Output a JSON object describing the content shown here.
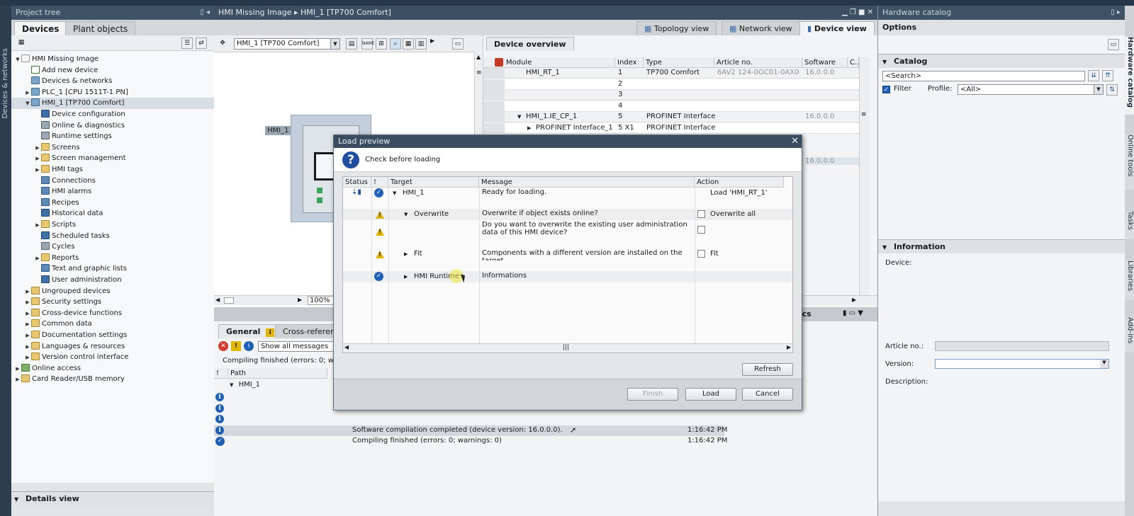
{
  "project_tree": {
    "title": "Project tree",
    "tabs": [
      "Devices",
      "Plant objects"
    ],
    "side_label": "Devices & networks",
    "items": [
      {
        "label": "HMI Missing Image",
        "indent": 0,
        "arrow": "▼",
        "icon": "doc"
      },
      {
        "label": "Add new device",
        "indent": 1,
        "arrow": "",
        "icon": "plus"
      },
      {
        "label": "Devices & networks",
        "indent": 1,
        "arrow": "",
        "icon": "dev"
      },
      {
        "label": "PLC_1 [CPU 1511T-1 PN]",
        "indent": 1,
        "arrow": "▶",
        "icon": "dev"
      },
      {
        "label": "HMI_1 [TP700 Comfort]",
        "indent": 1,
        "arrow": "▼",
        "icon": "dev"
      },
      {
        "label": "Device configuration",
        "indent": 2,
        "arrow": "",
        "icon": "blue"
      },
      {
        "label": "Online & diagnostics",
        "indent": 2,
        "arrow": "",
        "icon": "gear"
      },
      {
        "label": "Runtime settings",
        "indent": 2,
        "arrow": "",
        "icon": "gear"
      },
      {
        "label": "Screens",
        "indent": 2,
        "arrow": "▶",
        "icon": "folder"
      },
      {
        "label": "Screen management",
        "indent": 2,
        "arrow": "▶",
        "icon": "folder"
      },
      {
        "label": "HMI tags",
        "indent": 2,
        "arrow": "▶",
        "icon": "folder"
      },
      {
        "label": "Connections",
        "indent": 2,
        "arrow": "",
        "icon": "tag"
      },
      {
        "label": "HMI alarms",
        "indent": 2,
        "arrow": "",
        "icon": "tag"
      },
      {
        "label": "Recipes",
        "indent": 2,
        "arrow": "",
        "icon": "tag"
      },
      {
        "label": "Historical data",
        "indent": 2,
        "arrow": "",
        "icon": "blue"
      },
      {
        "label": "Scripts",
        "indent": 2,
        "arrow": "▶",
        "icon": "folder"
      },
      {
        "label": "Scheduled tasks",
        "indent": 2,
        "arrow": "",
        "icon": "blue"
      },
      {
        "label": "Cycles",
        "indent": 2,
        "arrow": "",
        "icon": "gear"
      },
      {
        "label": "Reports",
        "indent": 2,
        "arrow": "▶",
        "icon": "folder"
      },
      {
        "label": "Text and graphic lists",
        "indent": 2,
        "arrow": "",
        "icon": "tag"
      },
      {
        "label": "User administration",
        "indent": 2,
        "arrow": "",
        "icon": "blue"
      },
      {
        "label": "Ungrouped devices",
        "indent": 1,
        "arrow": "▶",
        "icon": "folder"
      },
      {
        "label": "Security settings",
        "indent": 1,
        "arrow": "▶",
        "icon": "folder"
      },
      {
        "label": "Cross-device functions",
        "indent": 1,
        "arrow": "▶",
        "icon": "folder"
      },
      {
        "label": "Common data",
        "indent": 1,
        "arrow": "▶",
        "icon": "folder"
      },
      {
        "label": "Documentation settings",
        "indent": 1,
        "arrow": "▶",
        "icon": "folder"
      },
      {
        "label": "Languages & resources",
        "indent": 1,
        "arrow": "▶",
        "icon": "folder"
      },
      {
        "label": "Version control interface",
        "indent": 1,
        "arrow": "▶",
        "icon": "folder"
      },
      {
        "label": "Online access",
        "indent": 0,
        "arrow": "▶",
        "icon": "green"
      },
      {
        "label": "Card Reader/USB memory",
        "indent": 0,
        "arrow": "▶",
        "icon": "folder"
      }
    ],
    "details_view": "Details view"
  },
  "editor": {
    "title": "HMI Missing Image  ▸  HMI_1 [TP700 Comfort]",
    "view_tabs": [
      "Topology view",
      "Network view",
      "Device view"
    ],
    "device_select": "HMI_1 [TP700 Comfort]",
    "device_label": "HMI_1",
    "zoom": "100%",
    "device_overview": {
      "title": "Device overview",
      "columns": [
        "Module",
        "Index",
        "Type",
        "Article no.",
        "Software or...",
        "C..."
      ],
      "rows": [
        {
          "module": "HMI_RT_1",
          "index": "1",
          "type": "TP700 Comfort",
          "article": "6AV2 124-0GC01-0AX0",
          "software": "16.0.0.0",
          "indent": 1,
          "arrow": ""
        },
        {
          "module": "",
          "index": "2",
          "type": "",
          "article": "",
          "software": "",
          "indent": 1,
          "arrow": ""
        },
        {
          "module": "",
          "index": "3",
          "type": "",
          "article": "",
          "software": "",
          "indent": 1,
          "arrow": ""
        },
        {
          "module": "",
          "index": "4",
          "type": "",
          "article": "",
          "software": "",
          "indent": 1,
          "arrow": ""
        },
        {
          "module": "HMI_1.IE_CP_1",
          "index": "5",
          "type": "PROFINET Interface",
          "article": "",
          "software": "16.0.0.0",
          "indent": 1,
          "arrow": "▼"
        },
        {
          "module": "PROFINET Interface_1",
          "index": "5 X1",
          "type": "PROFINET Interface",
          "article": "",
          "software": "",
          "indent": 2,
          "arrow": "▶"
        }
      ],
      "extra_software": "16.0.0.0"
    }
  },
  "inspector": {
    "tabs": [
      "General",
      "Cross-referen"
    ],
    "diagnostics_label": "stics",
    "filter": "Show all messages",
    "compile_status": "Compiling finished (errors: 0; warnin",
    "columns": [
      "!",
      "Path"
    ],
    "path_root": "HMI_1",
    "messages": [
      {
        "icon": "info",
        "text": "",
        "time": ""
      },
      {
        "icon": "info",
        "text": "",
        "time": ""
      },
      {
        "icon": "info",
        "text": "",
        "time": ""
      },
      {
        "icon": "info",
        "text": "Software compilation completed (device version: 16.0.0.0).",
        "time": "1:16:42 PM"
      },
      {
        "icon": "ok",
        "text": "Compiling finished (errors: 0; warnings: 0)",
        "time": "1:16:42 PM"
      }
    ]
  },
  "dialog": {
    "title": "Load preview",
    "heading": "Check before loading",
    "columns": [
      "Status",
      "!",
      "Target",
      "Message",
      "Action"
    ],
    "rows": [
      {
        "status": "load",
        "flag": "ok",
        "arrow": "▼",
        "target": "HMI_1",
        "message": "Ready for loading.",
        "action": "Load 'HMI_RT_1'",
        "checkbox": false,
        "indent": 0
      },
      {
        "status": "",
        "flag": "warn",
        "arrow": "▼",
        "target": "Overwrite",
        "message": "Overwrite if object exists online?",
        "action": "Overwrite all",
        "checkbox": true,
        "indent": 1
      },
      {
        "status": "",
        "flag": "warn",
        "arrow": "",
        "target": "",
        "message": "Do you want to overwrite the existing user administration data of this HMI device?",
        "action": "",
        "checkbox": true,
        "indent": 1
      },
      {
        "status": "",
        "flag": "warn",
        "arrow": "▶",
        "target": "Fit",
        "message": "Components with a different version are installed on the target ...",
        "action": "Fit",
        "checkbox": true,
        "indent": 1
      },
      {
        "status": "",
        "flag": "ok",
        "arrow": "▶",
        "target": "HMI Runtime",
        "message": "Informations",
        "action": "",
        "checkbox": false,
        "indent": 1
      }
    ],
    "refresh": "Refresh",
    "finish": "Finish",
    "load": "Load",
    "cancel": "Cancel"
  },
  "catalog": {
    "title": "Hardware catalog",
    "options": "Options",
    "catalog_label": "Catalog",
    "search_placeholder": "<Search>",
    "filter_label": "Filter",
    "profile_label": "Profile:",
    "profile_value": "<All>",
    "information": "Information",
    "device_label": "Device:",
    "article_label": "Article no.:",
    "version_label": "Version:",
    "description_label": "Description:",
    "side_tabs": [
      "Hardware catalog",
      "Online tools",
      "Tasks",
      "Libraries",
      "Add-ins"
    ]
  }
}
